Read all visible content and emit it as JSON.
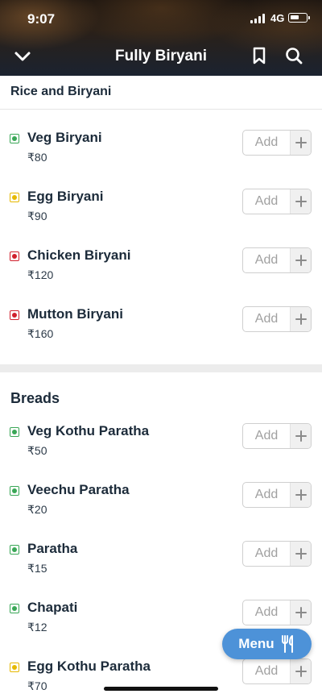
{
  "status_bar": {
    "time": "9:07",
    "network": "4G"
  },
  "header": {
    "title": "Fully Biryani"
  },
  "sub_header": {
    "label": "Rice and Biryani"
  },
  "sections": [
    {
      "items": [
        {
          "name": "Veg Biryani",
          "price": "₹80",
          "diet": "veg",
          "add_label": "Add"
        },
        {
          "name": "Egg Biryani",
          "price": "₹90",
          "diet": "egg",
          "add_label": "Add"
        },
        {
          "name": "Chicken Biryani",
          "price": "₹120",
          "diet": "nonveg",
          "add_label": "Add"
        },
        {
          "name": "Mutton Biryani",
          "price": "₹160",
          "diet": "nonveg",
          "add_label": "Add"
        }
      ]
    },
    {
      "title": "Breads",
      "items": [
        {
          "name": "Veg Kothu Paratha",
          "price": "₹50",
          "diet": "veg",
          "add_label": "Add"
        },
        {
          "name": "Veechu Paratha",
          "price": "₹20",
          "diet": "veg",
          "add_label": "Add"
        },
        {
          "name": "Paratha",
          "price": "₹15",
          "diet": "veg",
          "add_label": "Add"
        },
        {
          "name": "Chapati",
          "price": "₹12",
          "diet": "veg",
          "add_label": "Add"
        },
        {
          "name": "Egg Kothu Paratha",
          "price": "₹70",
          "diet": "egg",
          "add_label": "Add"
        }
      ]
    }
  ],
  "menu_button": {
    "label": "Menu",
    "icon": "fork-knife-icon"
  },
  "colors": {
    "veg": "#3aa757",
    "egg": "#e6b800",
    "nonveg": "#d0202d",
    "menu_fab": "#4d92d8"
  }
}
